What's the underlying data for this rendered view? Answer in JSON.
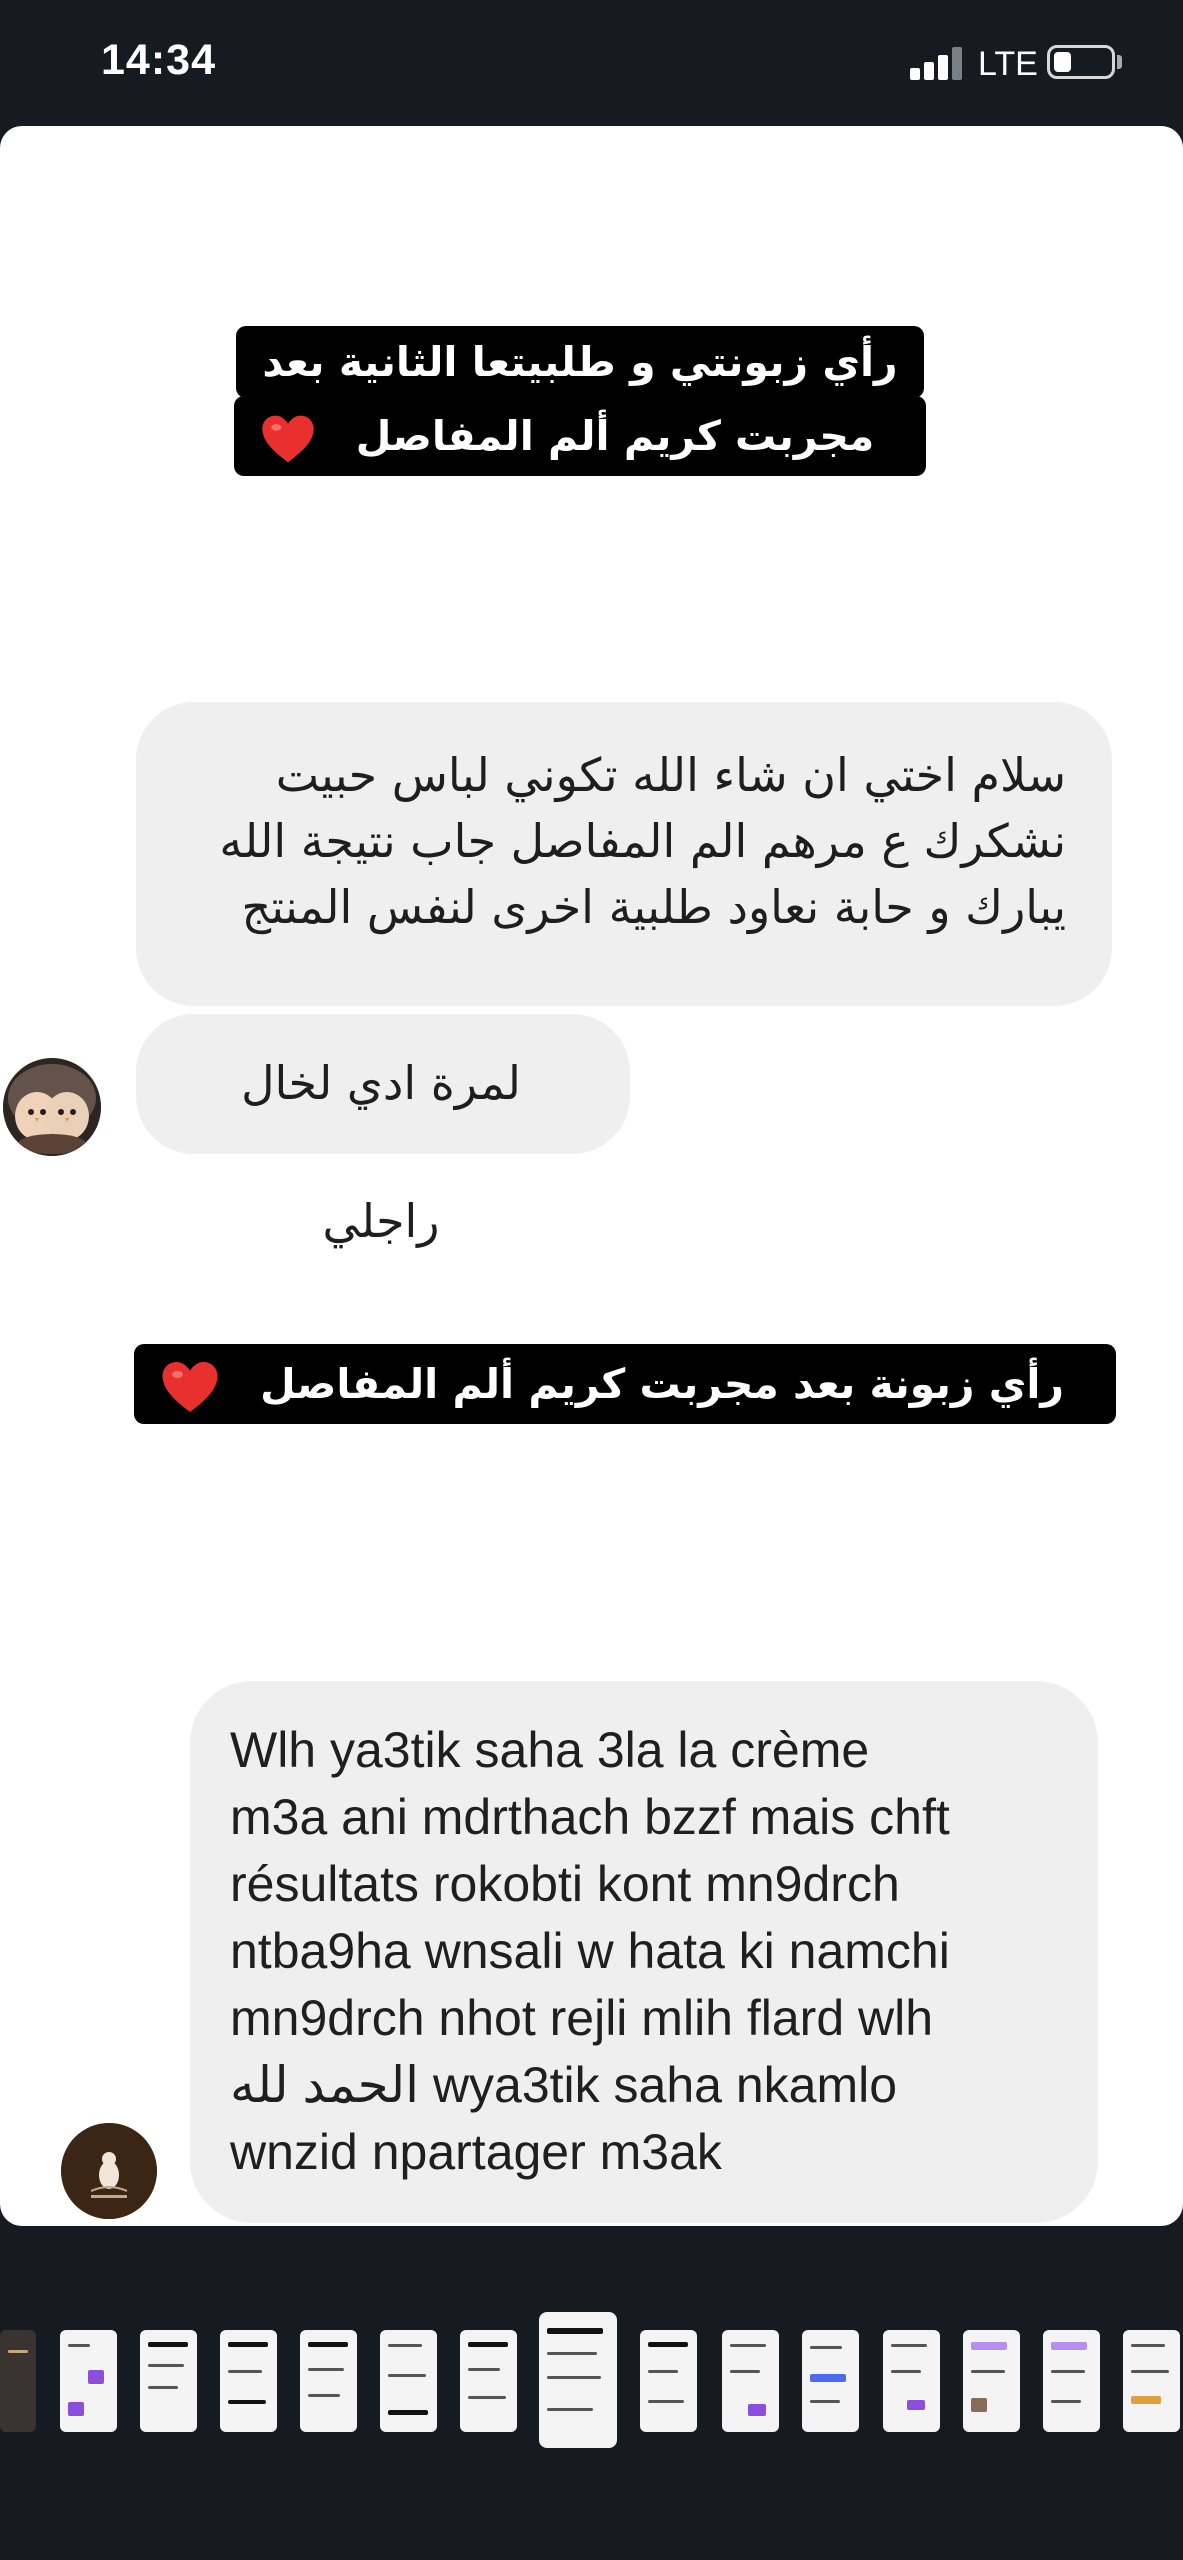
{
  "status_bar": {
    "time": "14:34",
    "network": "LTE",
    "signal_bars_filled": 3,
    "signal_bars_total": 4,
    "battery_level": 0.25
  },
  "story": {
    "caption_1": {
      "line_1": "رأي زبونتي و طلبيتعا الثانية بعد",
      "line_2": "مجربت كريم ألم المفاصل",
      "emoji": "❤️"
    },
    "message_1": {
      "lines": [
        "سلام اختي ان شاء الله تكوني لباس حبيت",
        "نشكرك ع  مرهم الم المفاصل جاب نتيجة الله",
        "يبارك  و حابة نعاود طلبية اخرى لنفس المنتج"
      ]
    },
    "message_2": {
      "text": "لمرة ادي لخال راجلي"
    },
    "caption_2": {
      "text": "رأي زبونة بعد مجربت كريم ألم المفاصل",
      "emoji": "❤️"
    },
    "message_3": {
      "lines": [
        "Wlh ya3tik saha 3la la  crème",
        "m3a ani mdrthach bzzf mais chft",
        "résultats rokobti kont mn9drch",
        "ntba9ha wnsali w hata ki namchi",
        "mn9drch nhot rejli mlih flard wlh",
        "الحمد لله wya3tik saha nkamlo",
        "wnzid npartager m3ak"
      ]
    }
  },
  "colors": {
    "background": "#161b22",
    "card": "#ffffff",
    "bubble": "#efefef",
    "caption_bg": "#000000",
    "heart": "#e8312f"
  },
  "thumbnails": {
    "count": 15,
    "active_index": 7
  }
}
